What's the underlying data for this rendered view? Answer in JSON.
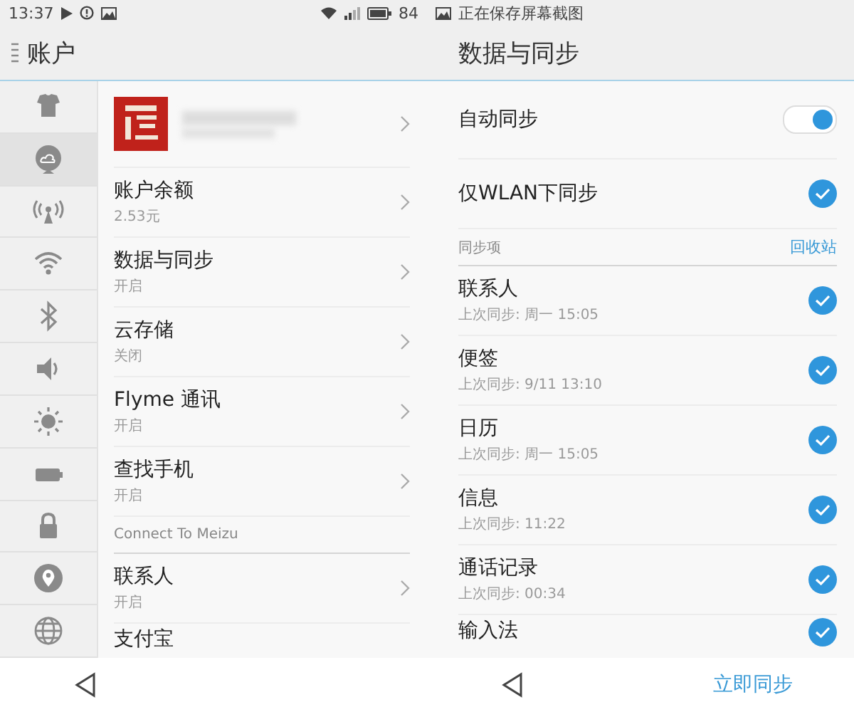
{
  "left": {
    "status_bar": {
      "time": "13:37",
      "battery": "84"
    },
    "header": {
      "title": "账户"
    },
    "sidebar": [
      {
        "selected": false
      },
      {
        "selected": true
      },
      {
        "selected": false
      },
      {
        "selected": false
      },
      {
        "selected": false
      },
      {
        "selected": false
      },
      {
        "selected": false
      },
      {
        "selected": false
      },
      {
        "selected": false
      },
      {
        "selected": false
      },
      {
        "selected": false
      }
    ],
    "menu_items": [
      {
        "title": "账户余额",
        "subtitle": "2.53元"
      },
      {
        "title": "数据与同步",
        "subtitle": "开启"
      },
      {
        "title": "云存储",
        "subtitle": "关闭"
      },
      {
        "title": "Flyme 通讯",
        "subtitle": "开启"
      },
      {
        "title": "查找手机",
        "subtitle": "开启"
      }
    ],
    "section": "Connect To Meizu",
    "section_items": [
      {
        "title": "联系人",
        "subtitle": "开启"
      },
      {
        "title": "支付宝"
      }
    ]
  },
  "right": {
    "status_bar": {
      "notification": "正在保存屏幕截图"
    },
    "header": {
      "title": "数据与同步"
    },
    "auto_sync": {
      "label": "自动同步",
      "on": true
    },
    "wlan_only": {
      "label": "仅WLAN下同步",
      "checked": true
    },
    "section": {
      "title": "同步项",
      "action": "回收站"
    },
    "sync_items": [
      {
        "title": "联系人",
        "subtitle": "上次同步: 周一 15:05",
        "checked": true
      },
      {
        "title": "便签",
        "subtitle": "上次同步: 9/11 13:10",
        "checked": true
      },
      {
        "title": "日历",
        "subtitle": "上次同步: 周一 15:05",
        "checked": true
      },
      {
        "title": "信息",
        "subtitle": "上次同步: 11:22",
        "checked": true
      },
      {
        "title": "通话记录",
        "subtitle": "上次同步: 00:34",
        "checked": true
      },
      {
        "title": "输入法",
        "checked": true
      }
    ],
    "bottom_bar": {
      "action": "立即同步"
    }
  }
}
